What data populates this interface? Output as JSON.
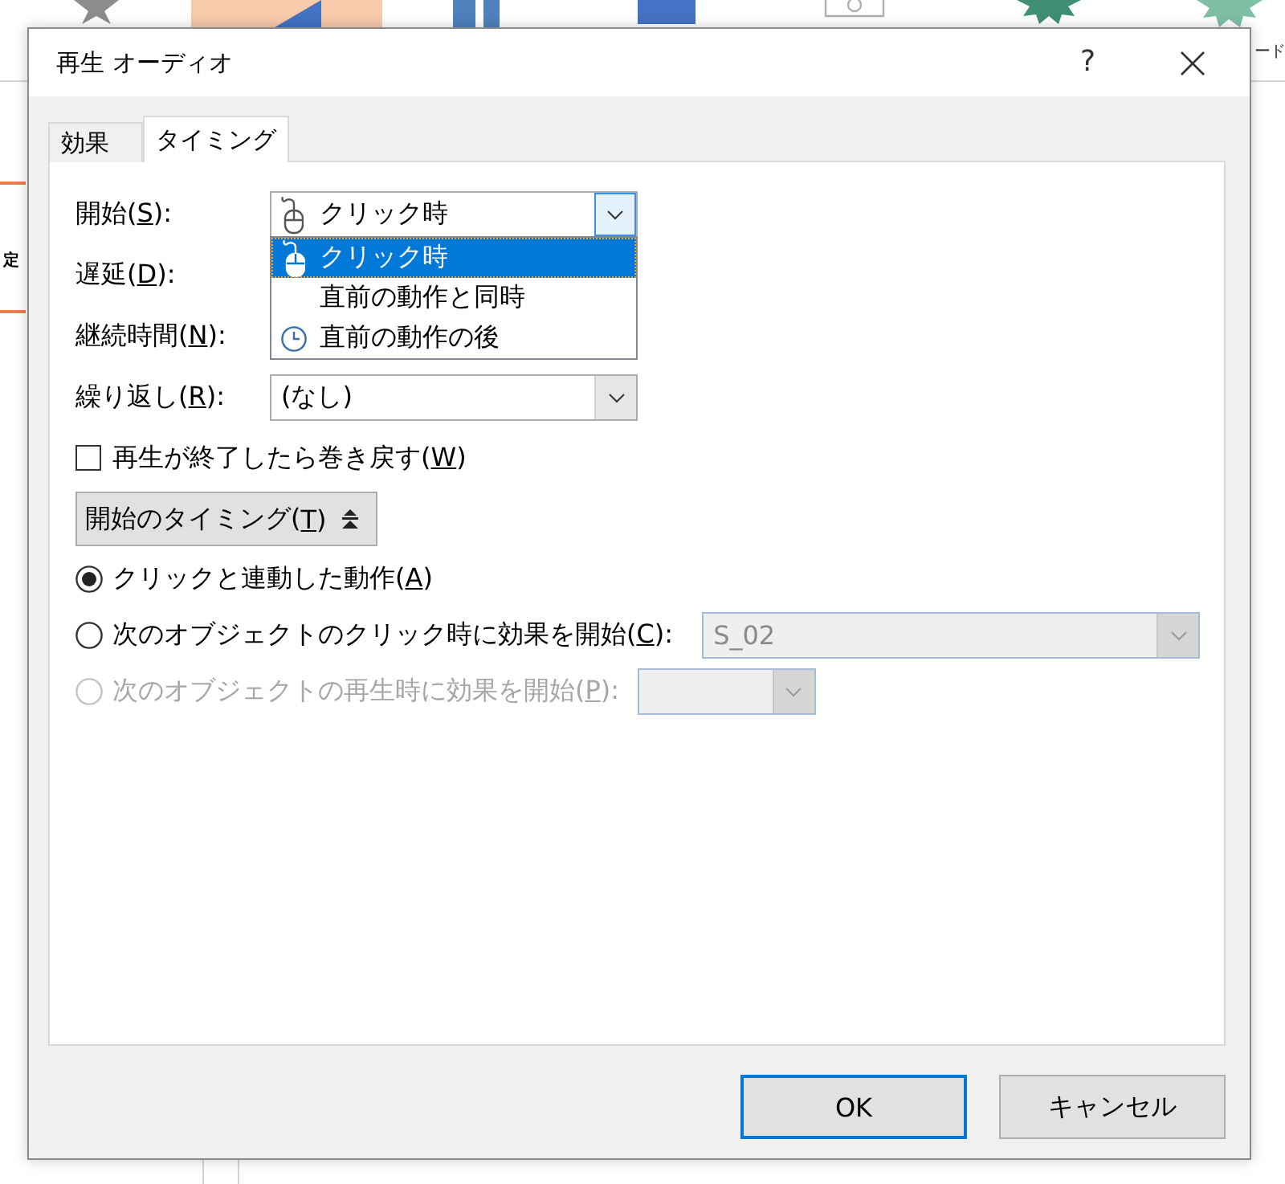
{
  "ribbon": {
    "group_label": "ード"
  },
  "thumbnail": {
    "text": "定",
    "selected": true
  },
  "dialog": {
    "title": "再生 オーディオ",
    "help": "?"
  },
  "tabs": [
    {
      "label": "効果",
      "selected": false
    },
    {
      "label": "タイミング",
      "selected": true
    }
  ],
  "start": {
    "label": {
      "before": "開始(",
      "access_key": "S",
      "after": "):"
    },
    "value": "クリック時",
    "expanded": true,
    "options": [
      {
        "text": "クリック時",
        "kind": "click",
        "selected": true
      },
      {
        "text": "直前の動作と同時",
        "kind": "plain",
        "selected": false
      },
      {
        "text": "直前の動作の後",
        "kind": "after",
        "selected": false
      }
    ]
  },
  "delay": {
    "label": {
      "before": "遅延(",
      "access_key": "D",
      "after": "):"
    }
  },
  "duration": {
    "label": {
      "before": "継続時間(",
      "access_key": "N",
      "after": "):"
    }
  },
  "repeat": {
    "label": {
      "before": "繰り返し(",
      "access_key": "R",
      "after": "):"
    },
    "value": "(なし)"
  },
  "rewind": {
    "label": {
      "before": "再生が終了したら巻き戻す(",
      "access_key": "W",
      "after": ")"
    },
    "checked": false
  },
  "triggers": {
    "label": {
      "before": "開始のタイミング(",
      "access_key": "T",
      "after": ")"
    },
    "expanded": true,
    "options": [
      {
        "label": {
          "before": "クリックと連動した動作(",
          "access_key": "A",
          "after": ")"
        },
        "selected": true,
        "disabled": false
      },
      {
        "label": {
          "before": "次のオブジェクトのクリック時に効果を開始(",
          "access_key": "C",
          "after": "):"
        },
        "selected": false,
        "disabled": false,
        "combo": {
          "value": "S_02",
          "disabled": true
        }
      },
      {
        "label": {
          "before": "次のオブジェクトの再生時に効果を開始(",
          "access_key": "P",
          "after": "):"
        },
        "selected": false,
        "disabled": true,
        "combo": {
          "disabled": true
        }
      }
    ]
  },
  "buttons": [
    {
      "label": "OK",
      "default": true
    },
    {
      "label": "キャンセル",
      "default": false
    }
  ]
}
